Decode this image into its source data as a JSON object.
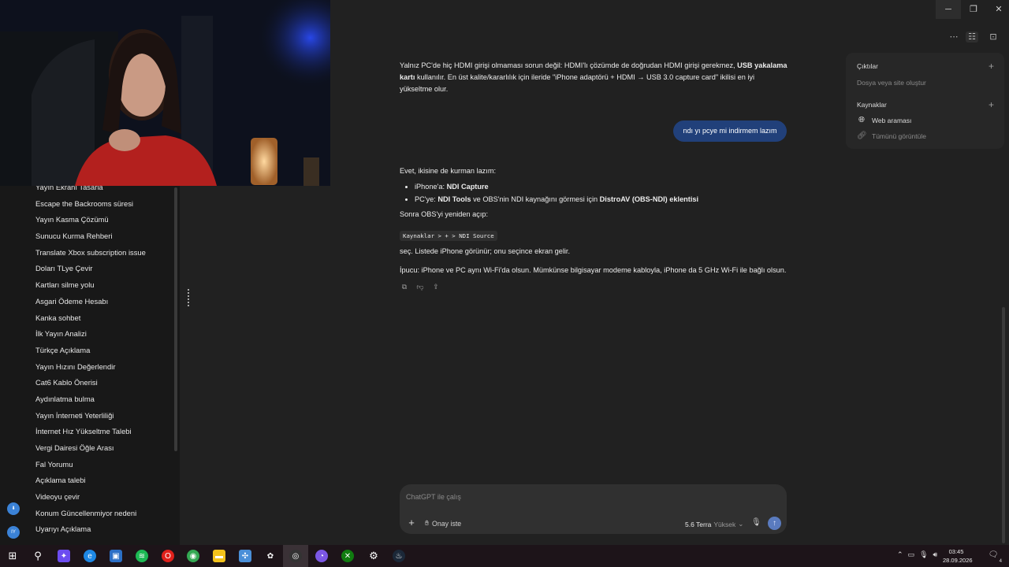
{
  "sidebar": {
    "items": [
      {
        "label": "Yayın Ekranı Tasarla"
      },
      {
        "label": "Escape the Backrooms süresi"
      },
      {
        "label": "Yayın Kasma Çözümü"
      },
      {
        "label": "Sunucu Kurma Rehberi"
      },
      {
        "label": "Translate Xbox subscription issue"
      },
      {
        "label": "Doları TLye Çevir"
      },
      {
        "label": "Kartları silme yolu"
      },
      {
        "label": "Asgari Ödeme Hesabı"
      },
      {
        "label": "Kanka sohbet"
      },
      {
        "label": "İlk Yayın Analizi"
      },
      {
        "label": "Türkçe Açıklama"
      },
      {
        "label": "Yayın Hızını Değerlendir"
      },
      {
        "label": "Cat6 Kablo Önerisi"
      },
      {
        "label": "Aydınlatma bulma"
      },
      {
        "label": "Yayın İnterneti Yeterliliği"
      },
      {
        "label": "İnternet Hız Yükseltme Talebi"
      },
      {
        "label": "Vergi Dairesi Öğle Arası"
      },
      {
        "label": "Fal Yorumu"
      },
      {
        "label": "Açıklama talebi"
      },
      {
        "label": "Videoyu çevir"
      },
      {
        "label": "Konum Güncellenmiyor nedeni"
      },
      {
        "label": "Uyarıyı Açıklama"
      }
    ],
    "avatar_initials": "IY"
  },
  "chat": {
    "para1_a": "Yalnız PC'de hiç HDMI girişi olmaması sorun değil: HDMI'lı çözümde de doğrudan HDMI girişi gerekmez, ",
    "para1_bold": "USB yakalama kartı",
    "para1_b": " kullanılır. En üst kalite/kararlılık için ileride \"iPhone adaptörü + HDMI → USB 3.0 capture card\" ikilisi en iyi yükseltme olur.",
    "user_message": "ndı yı pcye mi indirmem lazım",
    "reply_intro": "Evet, ikisine de kurman lazım:",
    "bullet1_a": "iPhone'a: ",
    "bullet1_bold": "NDI Capture",
    "bullet2_a": "PC'ye: ",
    "bullet2_bold1": "NDI Tools",
    "bullet2_b": " ve OBS'nin NDI kaynağını görmesi için ",
    "bullet2_bold2": "DistroAV (OBS-NDI) eklentisi",
    "reopen": "Sonra OBS'yi yeniden açıp:",
    "code": "Kaynaklar > + > NDI Source",
    "select_line": "seç. Listede iPhone görünür; onu seçince ekran gelir.",
    "tip": "İpucu: iPhone ve PC aynı Wi-Fi'da olsun. Mümkünse bilgisayar modeme kabloyla, iPhone da 5 GHz Wi-Fi ile bağlı olsun."
  },
  "panel": {
    "outputs_title": "Çıktılar",
    "outputs_sub": "Dosya veya site oluştur",
    "sources_title": "Kaynaklar",
    "web_search": "Web araması",
    "view_all": "Tümünü görüntüle"
  },
  "composer": {
    "placeholder": "ChatGPT ile çalış",
    "approve": "Onay iste",
    "model_name": "5.6 Terra",
    "model_level": "Yüksek"
  },
  "taskbar": {
    "time": "03:45",
    "date": "28.09.2026",
    "notification_count": "4"
  },
  "colors": {
    "background": "#212121",
    "sidebar": "#181818",
    "user_bubble": "#21407a",
    "send_button": "#5a7bbf"
  }
}
